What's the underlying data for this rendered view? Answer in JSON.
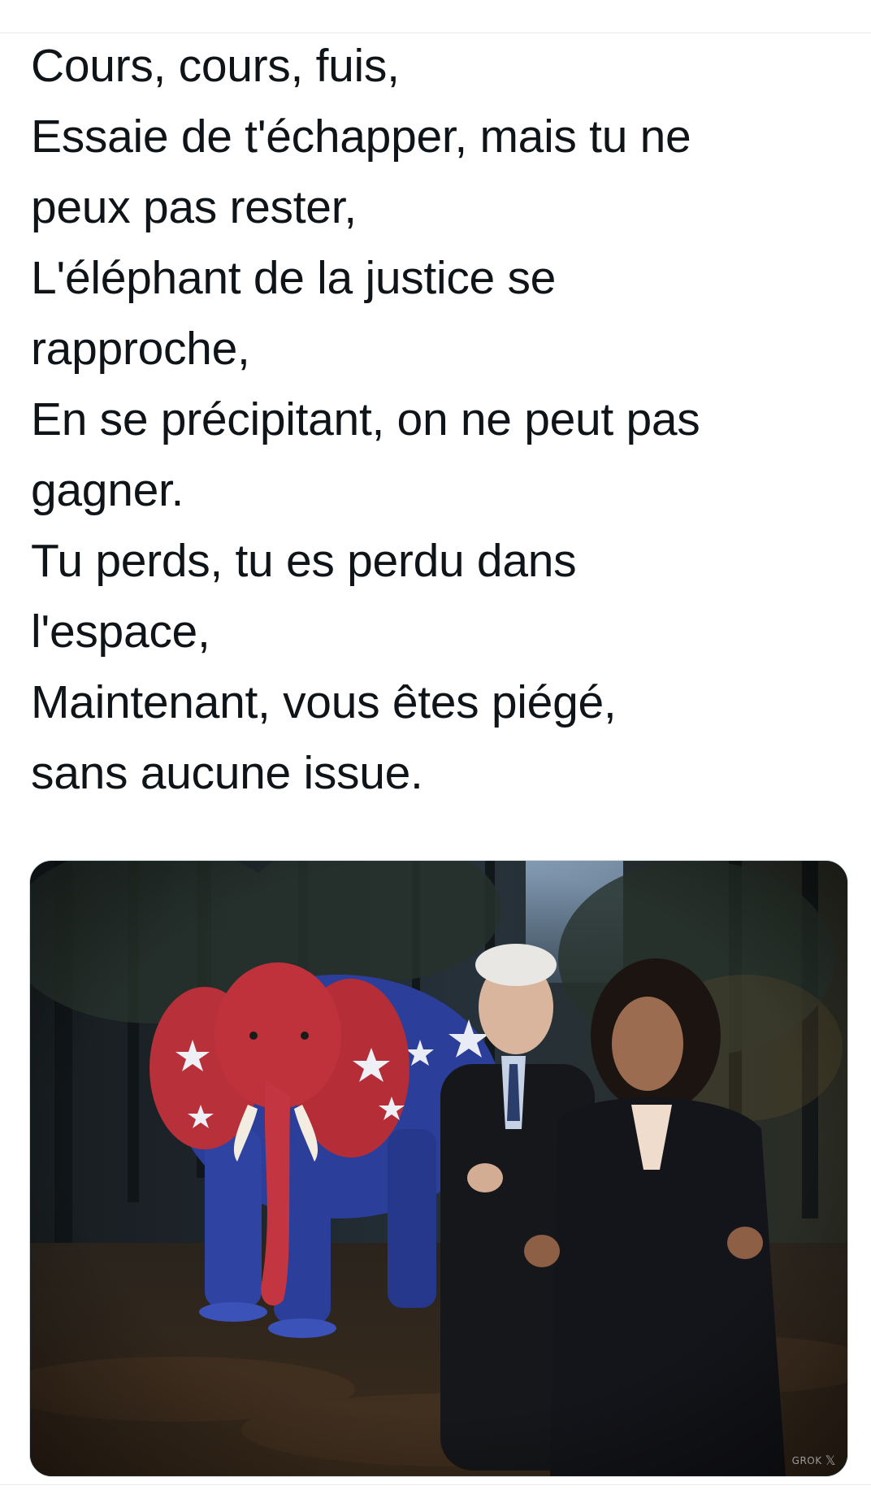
{
  "tweet": {
    "lines": [
      "Cours, cours, fuis,",
      "Essaie de t'échapper, mais tu ne",
      "peux pas rester,",
      "L'éléphant de la justice se",
      "rapproche,",
      "En se précipitant, on ne peut pas",
      "gagner.",
      "Tu perds, tu es perdu dans",
      "l'espace,",
      "Maintenant, vous êtes piégé,",
      "sans aucune issue."
    ]
  },
  "media": {
    "watermark": "GROK",
    "watermark_icon": "x-logo-icon",
    "colors": {
      "elephant_red": "#c0323b",
      "elephant_blue": "#2b3f9a",
      "forest_dark": "#1e2629",
      "ground": "#3a2a1c",
      "suit_black": "#16171a"
    }
  }
}
